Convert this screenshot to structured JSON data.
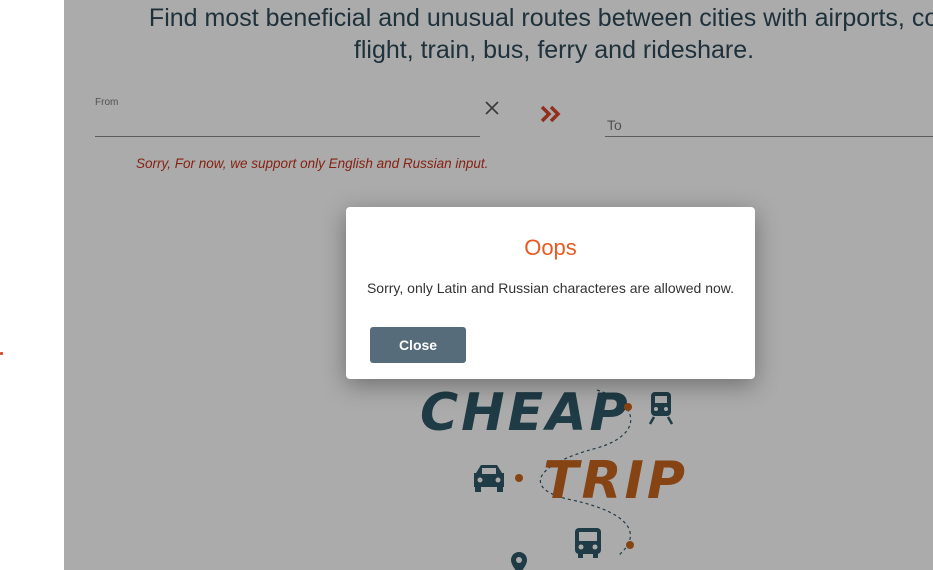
{
  "header": {
    "headline_line1": "Find most beneficial and unusual routes between cities with airports, com",
    "headline_line2": "flight, train, bus, ferry and rideshare."
  },
  "search": {
    "from_label": "From",
    "from_value": "",
    "to_placeholder": "To",
    "clear_icon": "close-icon",
    "swap_icon": "double-chevron-right-icon",
    "error_message": "Sorry, For now, we support only English and Russian input."
  },
  "logo": {
    "word1": "CHEAP",
    "word2": "TRIP",
    "icons": [
      "train-icon",
      "car-icon",
      "bus-icon",
      "location-pin-icon"
    ]
  },
  "dialog": {
    "title": "Oops",
    "message": "Sorry, only Latin and Russian characteres are allowed now.",
    "close_label": "Close"
  },
  "colors": {
    "accent_orange": "#e85a22",
    "error_red": "#c8331c",
    "headline": "#2f4a58",
    "button": "#566c7a",
    "logo_teal": "#2f5968",
    "logo_orange": "#c8651f"
  }
}
